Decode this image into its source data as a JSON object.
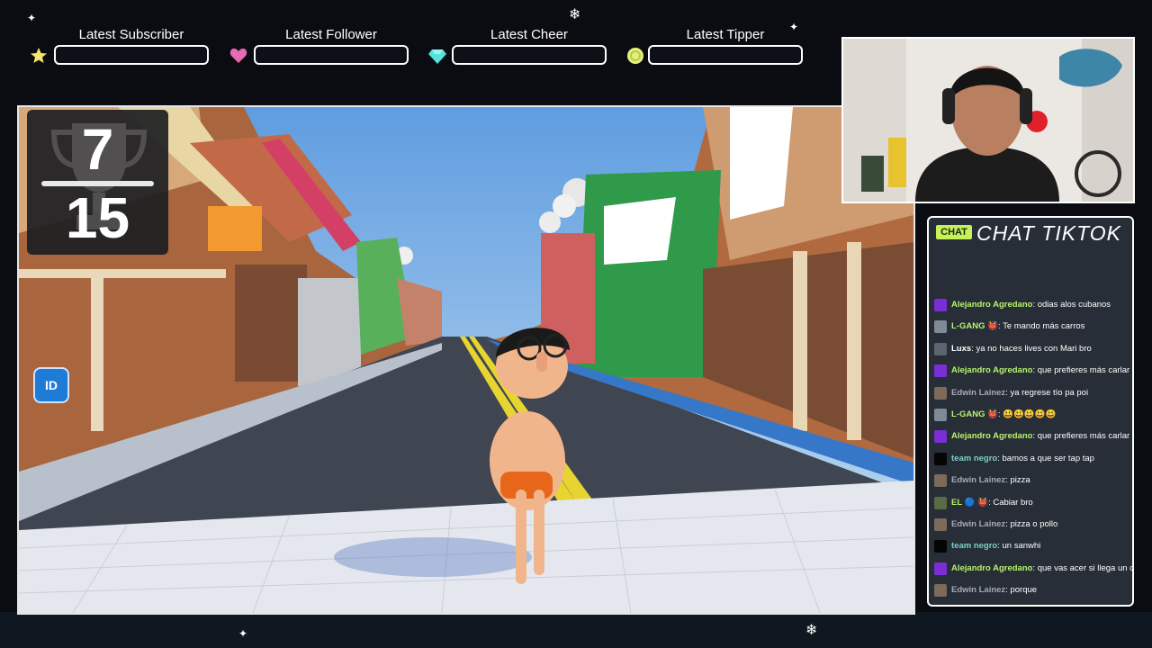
{
  "alerts": [
    {
      "label": "Latest Subscriber",
      "icon": "star-icon",
      "color": "#f4e56f",
      "value": ""
    },
    {
      "label": "Latest Follower",
      "icon": "heart-icon",
      "color": "#e86ab4",
      "value": ""
    },
    {
      "label": "Latest Cheer",
      "icon": "gem-icon",
      "color": "#53e2dd",
      "value": ""
    },
    {
      "label": "Latest Tipper",
      "icon": "coin-icon",
      "color": "#e3f07a",
      "value": ""
    }
  ],
  "score": {
    "current": "7",
    "total": "15"
  },
  "id_button": {
    "label": "ID"
  },
  "chat": {
    "badge": "CHAT",
    "title": "CHAT TIKTOK",
    "messages": [
      {
        "user": "Alejandro Agredano",
        "color": "#b7f36c",
        "avatar": "#7a2fd6",
        "badge": "",
        "text": "odias alos cubanos"
      },
      {
        "user": "L-GANG",
        "color": "#b7f36c",
        "avatar": "#7f8a96",
        "badge": "👹",
        "text": "Te mando más carros"
      },
      {
        "user": "Luxs",
        "color": "#ffffff",
        "avatar": "#5b6470",
        "badge": "",
        "text": "ya no haces lives con Mari bro"
      },
      {
        "user": "Alejandro Agredano",
        "color": "#b7f36c",
        "avatar": "#7a2fd6",
        "badge": "",
        "text": "que prefieres más carlar"
      },
      {
        "user": "Edwin Lainez",
        "color": "#a8a8b8",
        "avatar": "#7d6a5a",
        "badge": "",
        "text": "ya regrese tío pa poi"
      },
      {
        "user": "L-GANG",
        "color": "#b7f36c",
        "avatar": "#7f8a96",
        "badge": "👹",
        "text": "😃😃😃😃😃"
      },
      {
        "user": "Alejandro Agredano",
        "color": "#b7f36c",
        "avatar": "#7a2fd6",
        "badge": "",
        "text": "que prefieres más carlar"
      },
      {
        "user": "team negro",
        "color": "#7ad0c8",
        "avatar": "#050505",
        "badge": "",
        "text": "bamos a que ser tap tap"
      },
      {
        "user": "Edwin Lainez",
        "color": "#a8a8b8",
        "avatar": "#7d6a5a",
        "badge": "",
        "text": "pizza"
      },
      {
        "user": "EL",
        "color": "#b7f36c",
        "avatar": "#5a6b44",
        "badge": "🔵 👹",
        "text": "Cabiar bro"
      },
      {
        "user": "Edwin Lainez",
        "color": "#a8a8b8",
        "avatar": "#7d6a5a",
        "badge": "",
        "text": "pizza o pollo"
      },
      {
        "user": "team negro",
        "color": "#7ad0c8",
        "avatar": "#050505",
        "badge": "",
        "text": "un sanwhi"
      },
      {
        "user": "Alejandro Agredano",
        "color": "#b7f36c",
        "avatar": "#7a2fd6",
        "badge": "",
        "text": "que vas acer si llega un c"
      },
      {
        "user": "Edwin Lainez",
        "color": "#a8a8b8",
        "avatar": "#7d6a5a",
        "badge": "",
        "text": "porque"
      }
    ]
  }
}
